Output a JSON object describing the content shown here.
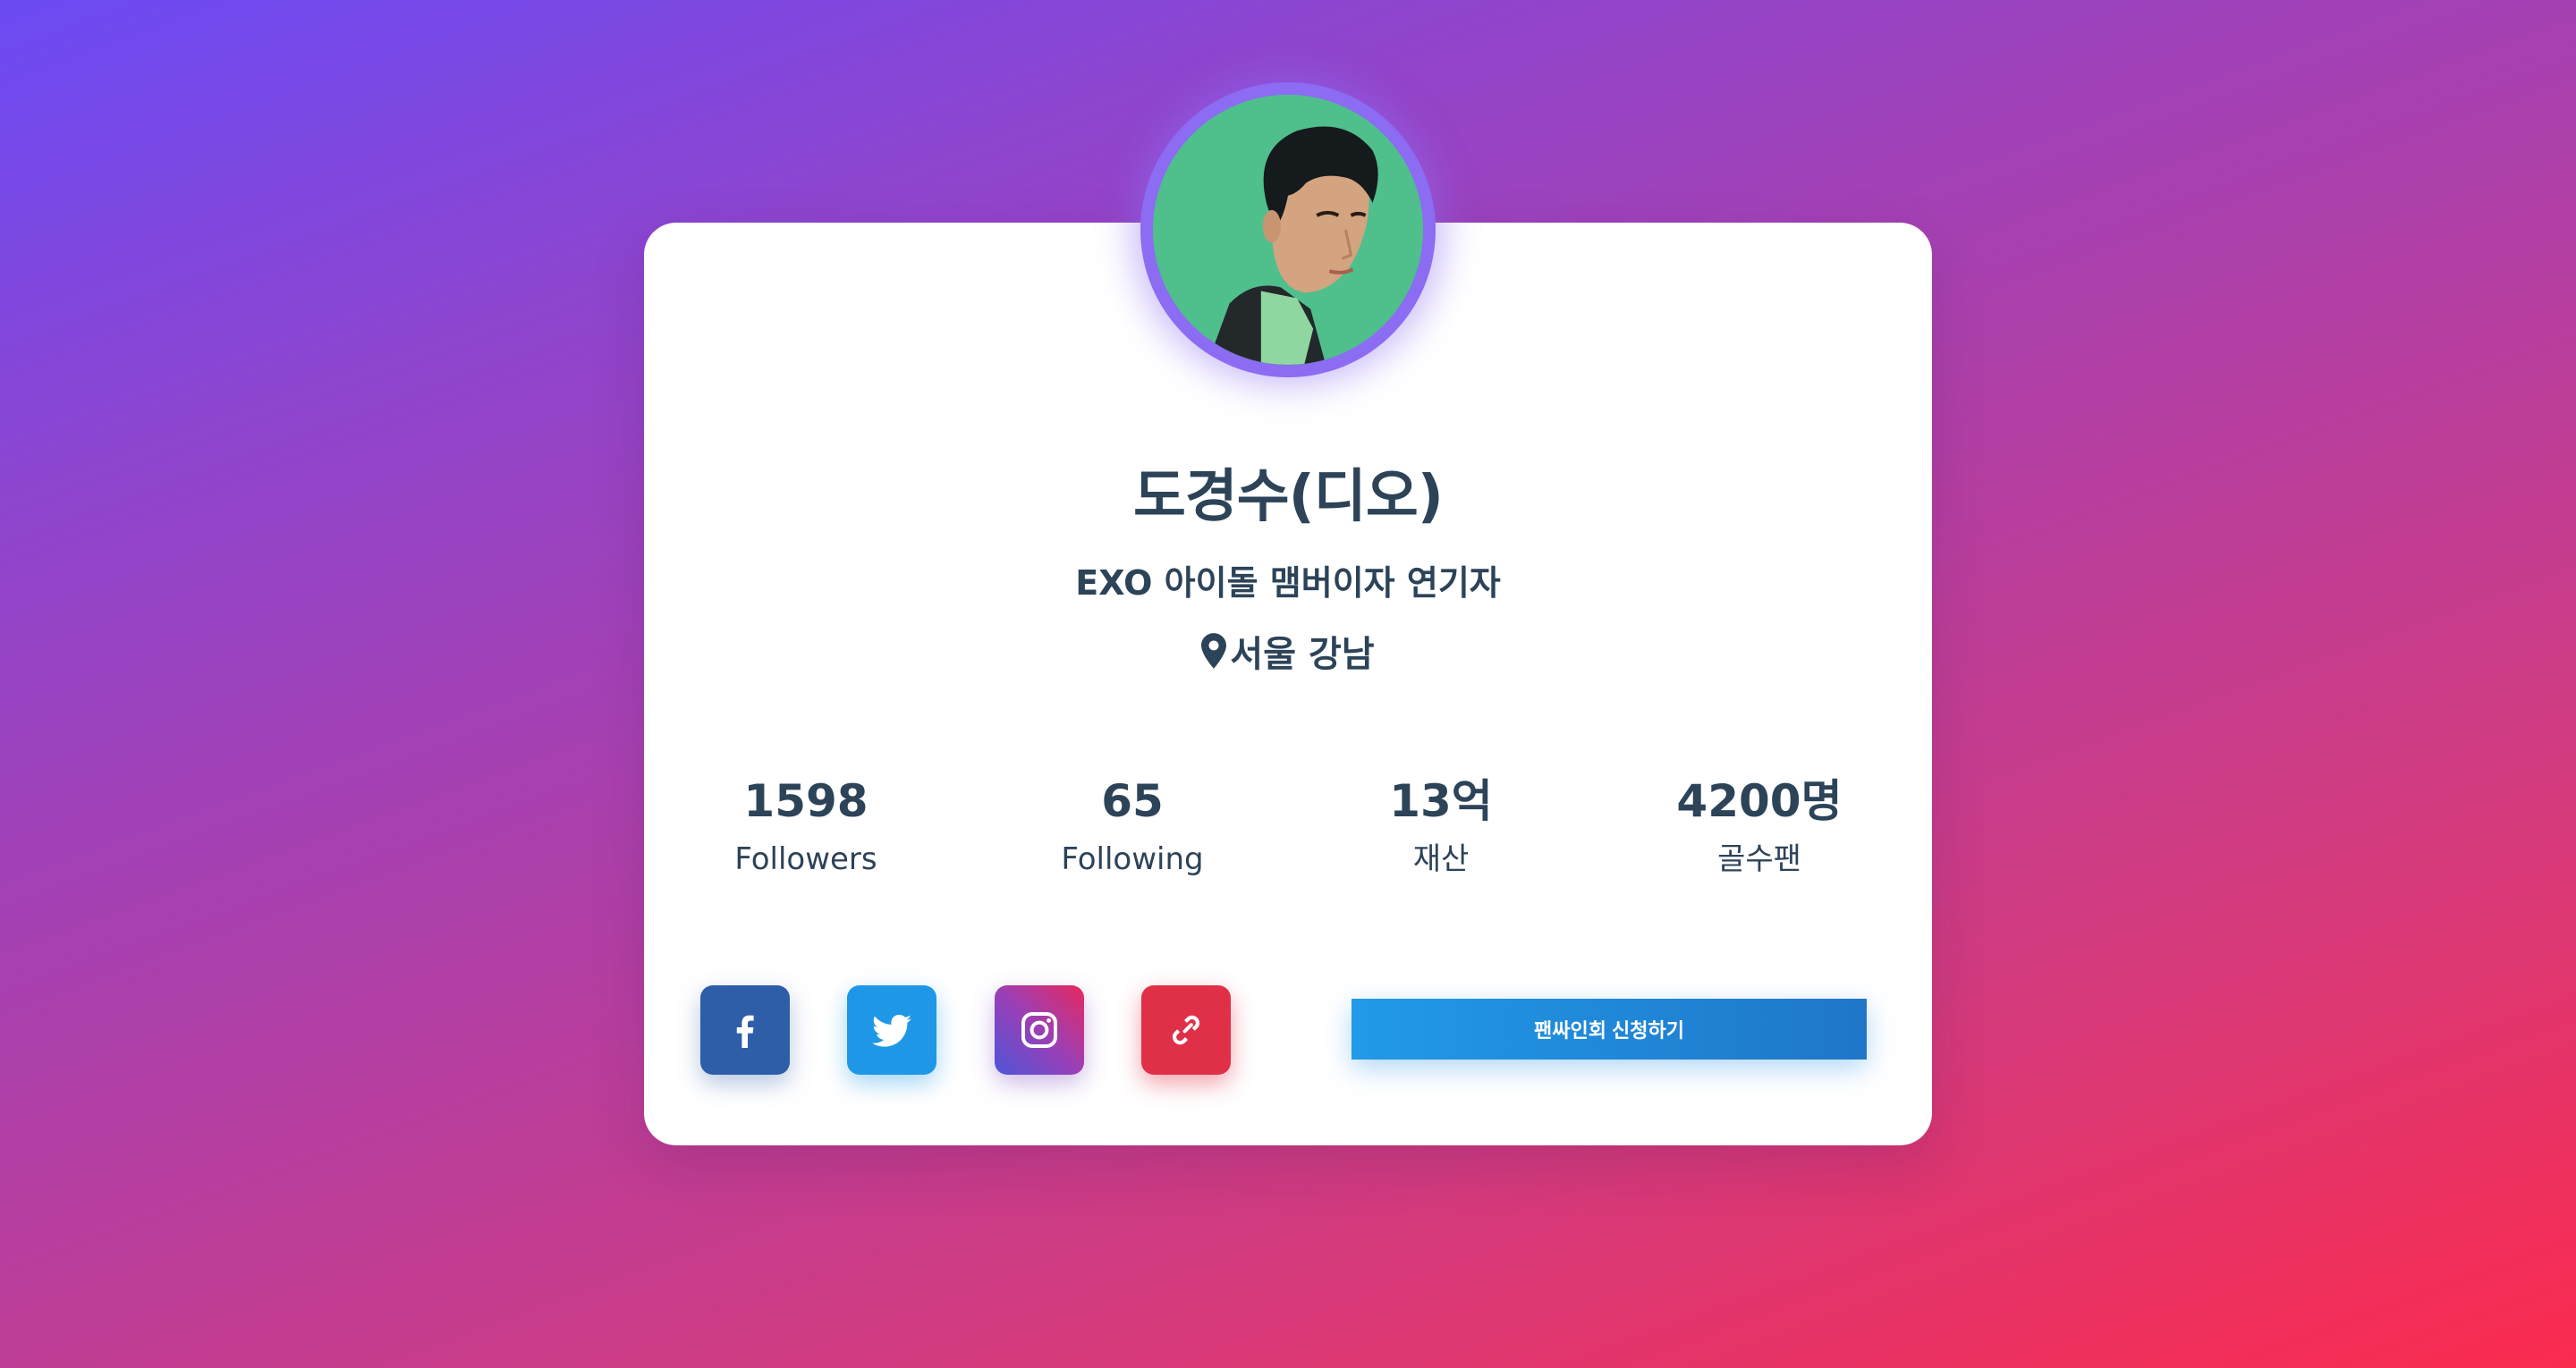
{
  "profile": {
    "name": "도경수(디오)",
    "subtitle": "EXO 아이돌 맴버이자 연기자",
    "location": "서울 강남",
    "avatar_icon": "profile-photo"
  },
  "stats": [
    {
      "value": "1598",
      "label": "Followers"
    },
    {
      "value": "65",
      "label": "Following"
    },
    {
      "value": "13억",
      "label": "재산"
    },
    {
      "value": "4200명",
      "label": "골수팬"
    }
  ],
  "social": {
    "facebook_icon": "facebook-icon",
    "twitter_icon": "twitter-icon",
    "instagram_icon": "instagram-icon",
    "link_icon": "link-icon"
  },
  "cta": {
    "label": "팬싸인회 신청하기"
  },
  "colors": {
    "text": "#2c4358",
    "facebook": "#2f5ea8",
    "twitter": "#1e98e6",
    "link": "#e03048",
    "cta": "#219ae8",
    "avatar_ring": "#8b6cf2"
  }
}
